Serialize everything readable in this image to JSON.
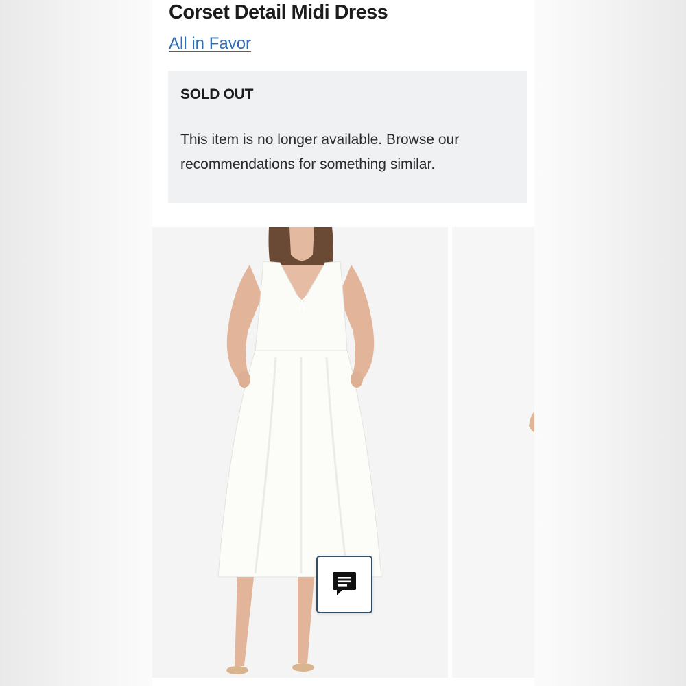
{
  "product": {
    "title": "Corset Detail Midi Dress",
    "brand": "All in Favor"
  },
  "availability": {
    "status": "SOLD OUT",
    "message": "This item is no longer available. Browse our recommendations for something similar."
  },
  "gallery": {
    "images": [
      {
        "icon": "white-dress-model-photo"
      },
      {
        "icon": "dress-model-photo-partial"
      }
    ]
  },
  "chat": {
    "icon": "chat-message-icon"
  },
  "colors": {
    "brand_link": "#2f6db4",
    "notice_bg": "#f0f1f3",
    "chat_border": "#2f4e6a"
  }
}
